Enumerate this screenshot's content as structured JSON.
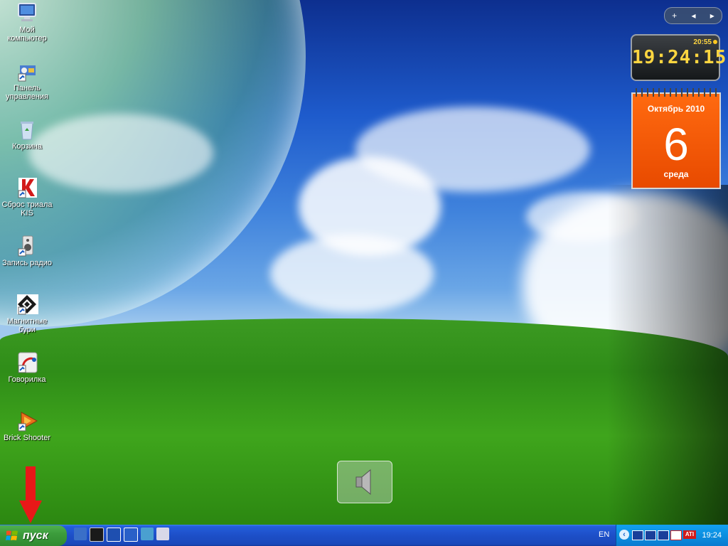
{
  "desktop_icons": [
    {
      "label": "Мой компьютер",
      "icon": "my-computer-icon"
    },
    {
      "label": "Панель управления",
      "icon": "control-panel-icon"
    },
    {
      "label": "Корзина",
      "icon": "recycle-bin-icon"
    },
    {
      "label": "Сброс триала KIS",
      "icon": "kaspersky-icon"
    },
    {
      "label": "Запись радио",
      "icon": "radio-record-icon"
    },
    {
      "label": "Магнитные бури",
      "icon": "magnetic-storms-icon"
    },
    {
      "label": "Говорилка",
      "icon": "govorilka-icon"
    },
    {
      "label": "Brick Shooter",
      "icon": "brick-shooter-icon"
    }
  ],
  "gadget_toolbar": {
    "add": "+",
    "prev": "◂",
    "next": "▸"
  },
  "clock": {
    "time": "19:24:15",
    "alarm": "20:55"
  },
  "calendar": {
    "month_year": "Октябрь 2010",
    "day": "6",
    "weekday": "среда"
  },
  "taskbar": {
    "start_label": "пуск",
    "language": "EN",
    "tray_time": "19:24",
    "tray_chevron": "‹",
    "tray_ati": "ATI"
  },
  "colors": {
    "taskbar": "#245edb",
    "start_button": "#3c9c3c",
    "tray": "#0c8fe0",
    "arrow": "#e81818",
    "calendar": "#ff6a10",
    "clock_digits": "#ffd640"
  }
}
